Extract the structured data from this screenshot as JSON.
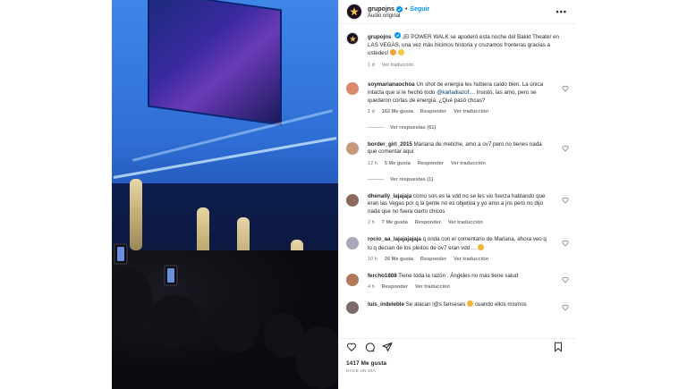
{
  "post": {
    "username": "grupojns",
    "separator": "•",
    "follow_label": "Seguir",
    "audio": "Audio original",
    "more_label": "•••"
  },
  "caption": {
    "username": "grupojns",
    "text": "¡El POWER WALK se apoderó esta noche del Bakkt Theater en LAS VEGAS, una vez más hicimos historia y cruzamos fronteras gracias a ustedes!",
    "time": "1 d",
    "translate": "Ver traducción"
  },
  "comments": [
    {
      "username": "soymarianaochoa",
      "text_before": "Un shot de energía les hubiera caído bien. La única intacta que si le hechó todo",
      "mention": "@karladiazof....",
      "text_after": "insisto, las amo, pero se quedaron cortas de energía. ¿Qué pasó chcas?",
      "time": "1 d",
      "likes": "162 Me gusta",
      "reply": "Responder",
      "translate": "Ver traducción",
      "replies": "Ver respuestas (61)",
      "avatar_color": "#d98a6b"
    },
    {
      "username": "border_girl_2015",
      "text": "Mariana de metiche, amo a ov7 pero no tienes nada que comentar aquí",
      "time": "12 h",
      "likes": "5 Me gusta",
      "reply": "Responder",
      "translate": "Ver traducción",
      "replies": "Ver respuestas (1)",
      "avatar_color": "#c49a7a"
    },
    {
      "username": "dhenally_lajajaja",
      "text": "cómo son es la vdd no se les vio fuerza hablando que eran las Vegas por q la gente no es objetiva y yo amo a jns pero no dijo nada que no fuera cierto chicos",
      "time": "2 h",
      "likes": "7 Me gusta",
      "reply": "Responder",
      "translate": "Ver traducción",
      "avatar_color": "#8a6a5a"
    },
    {
      "username": "rocio_aa_lajajajajaja",
      "text": "q onda con el comentario de Mariana, ahora veo q lo q decían de los pleitos de ov7 eran vdd ...",
      "time": "10 h",
      "likes": "26 Me gusta",
      "reply": "Responder",
      "translate": "Ver traducción",
      "avatar_color": "#a8a8b8"
    },
    {
      "username": "fercho1808",
      "text": "Tiene toda la razón . Ángeles no más tiene salud",
      "time": "4 h",
      "reply": "Responder",
      "translate": "Ver traducción",
      "avatar_color": "#b07a5a"
    },
    {
      "username": "luis_indeleble",
      "text": "Se atacan l@s fanseses",
      "text_after": "cuando ellos mismos",
      "avatar_color": "#7a6a6a"
    }
  ],
  "footer": {
    "likes": "1417 Me gusta",
    "ago": "HACE UN DÍA"
  },
  "icons": {
    "heart": "heart-icon",
    "comment": "comment-icon",
    "share": "share-icon",
    "save": "bookmark-icon",
    "verified": "verified-badge-icon"
  },
  "colors": {
    "link": "#0095f6",
    "mention": "#00376b",
    "muted": "#737373",
    "text": "#262626"
  }
}
